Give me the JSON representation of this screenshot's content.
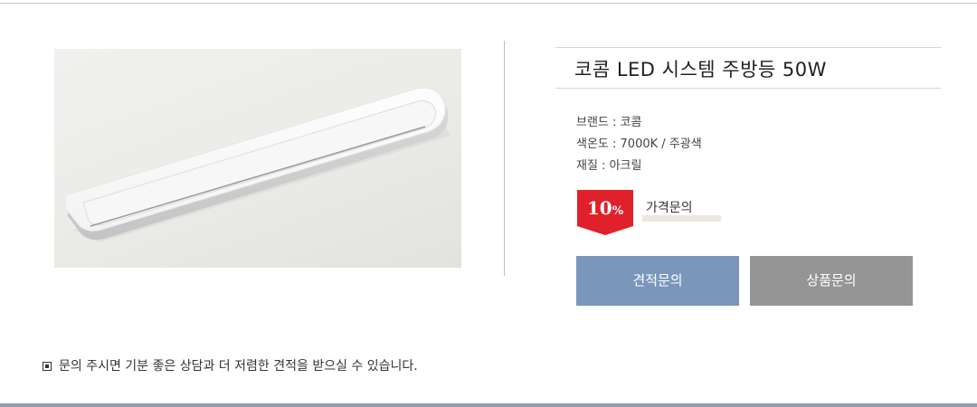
{
  "product": {
    "title": "코콤 LED 시스템 주방등 50W",
    "image_alt": "코콤 LED 시스템 주방등 50W"
  },
  "specs": [
    "브랜드 : 코콤",
    "색온도 : 7000K / 주광색",
    "재질 : 아크릴"
  ],
  "discount": {
    "number": "10",
    "unit": "%"
  },
  "price": {
    "inquiry_label": "가격문의"
  },
  "buttons": {
    "quote": "견적문의",
    "product": "상품문의"
  },
  "notice": {
    "text": "문의 주시면 기분 좋은 상담과 더 저렴한 견적을 받으실 수 있습니다."
  },
  "colors": {
    "quote_button": "#7a97bb",
    "product_button": "#959595",
    "discount_badge": "#e0202b",
    "bottom_bar": "#8e9bb0"
  }
}
